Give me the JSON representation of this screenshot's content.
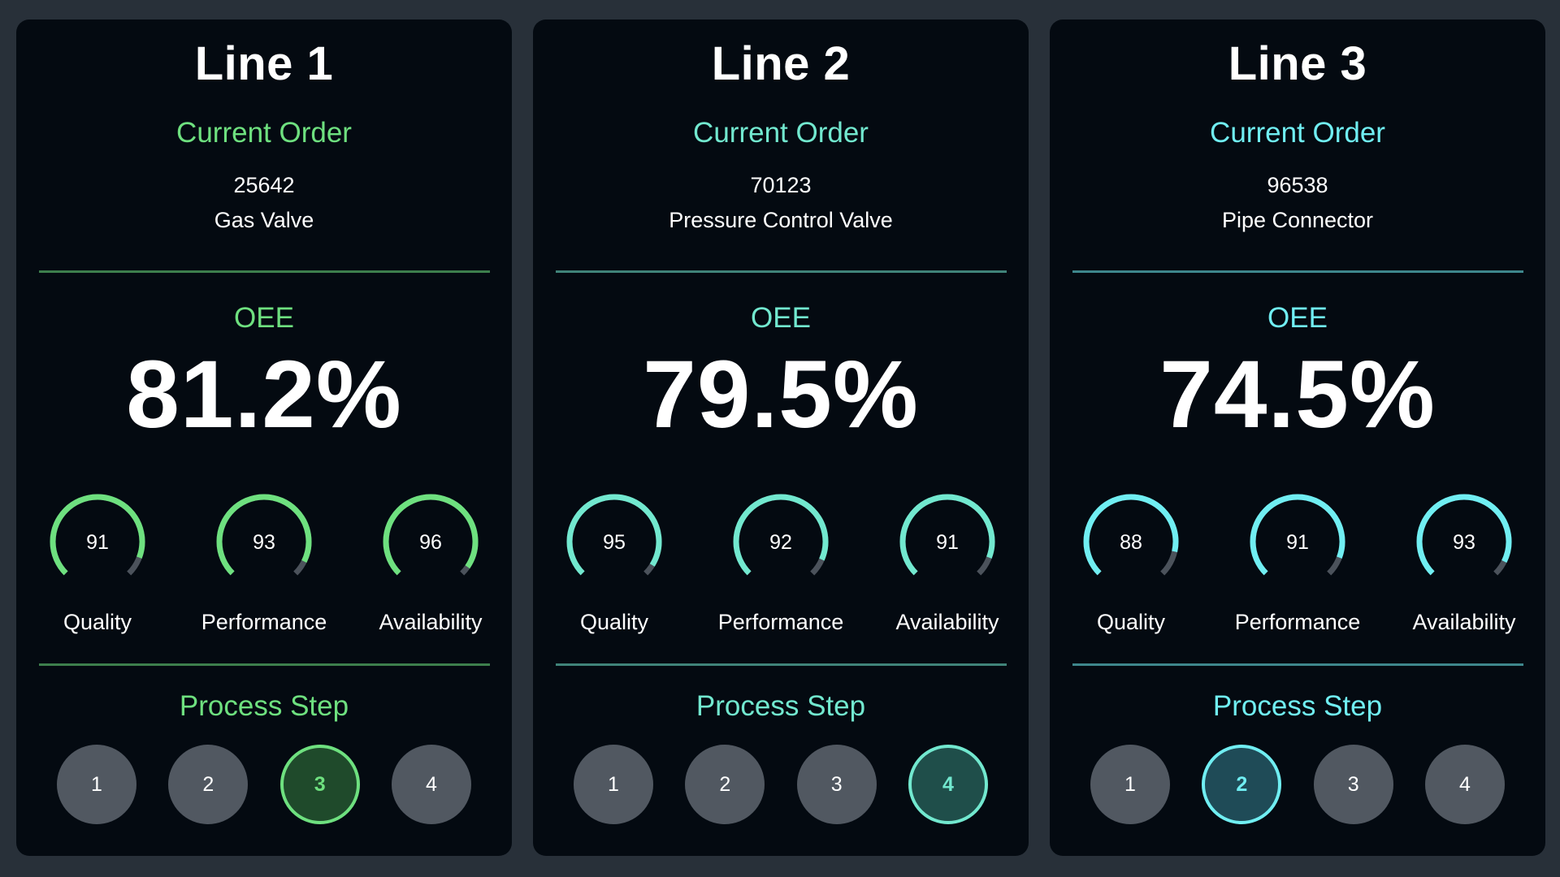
{
  "lines": [
    {
      "title": "Line 1",
      "accent": "#6ee07f",
      "current_order_label": "Current Order",
      "order_number": "25642",
      "product": "Gas Valve",
      "oee_label": "OEE",
      "oee_value": "81.2%",
      "metrics": [
        {
          "value": 91,
          "label": "Quality"
        },
        {
          "value": 93,
          "label": "Performance"
        },
        {
          "value": 96,
          "label": "Availability"
        }
      ],
      "process_step_label": "Process Step",
      "steps": [
        "1",
        "2",
        "3",
        "4"
      ],
      "active_step": 3,
      "active_step_fill": "#1f4a2b"
    },
    {
      "title": "Line 2",
      "accent": "#72e8cf",
      "current_order_label": "Current Order",
      "order_number": "70123",
      "product": "Pressure Control Valve",
      "oee_label": "OEE",
      "oee_value": "79.5%",
      "metrics": [
        {
          "value": 95,
          "label": "Quality"
        },
        {
          "value": 92,
          "label": "Performance"
        },
        {
          "value": 91,
          "label": "Availability"
        }
      ],
      "process_step_label": "Process Step",
      "steps": [
        "1",
        "2",
        "3",
        "4"
      ],
      "active_step": 4,
      "active_step_fill": "#1f4e4a"
    },
    {
      "title": "Line 3",
      "accent": "#70eef2",
      "current_order_label": "Current Order",
      "order_number": "96538",
      "product": "Pipe Connector",
      "oee_label": "OEE",
      "oee_value": "74.5%",
      "metrics": [
        {
          "value": 88,
          "label": "Quality"
        },
        {
          "value": 91,
          "label": "Performance"
        },
        {
          "value": 93,
          "label": "Availability"
        }
      ],
      "process_step_label": "Process Step",
      "steps": [
        "1",
        "2",
        "3",
        "4"
      ],
      "active_step": 2,
      "active_step_fill": "#1f4b57"
    }
  ],
  "colors": {
    "page_background": "#283039",
    "panel_background": "#040a11",
    "gauge_track": "#4b525b",
    "step_inactive": "#515861"
  }
}
